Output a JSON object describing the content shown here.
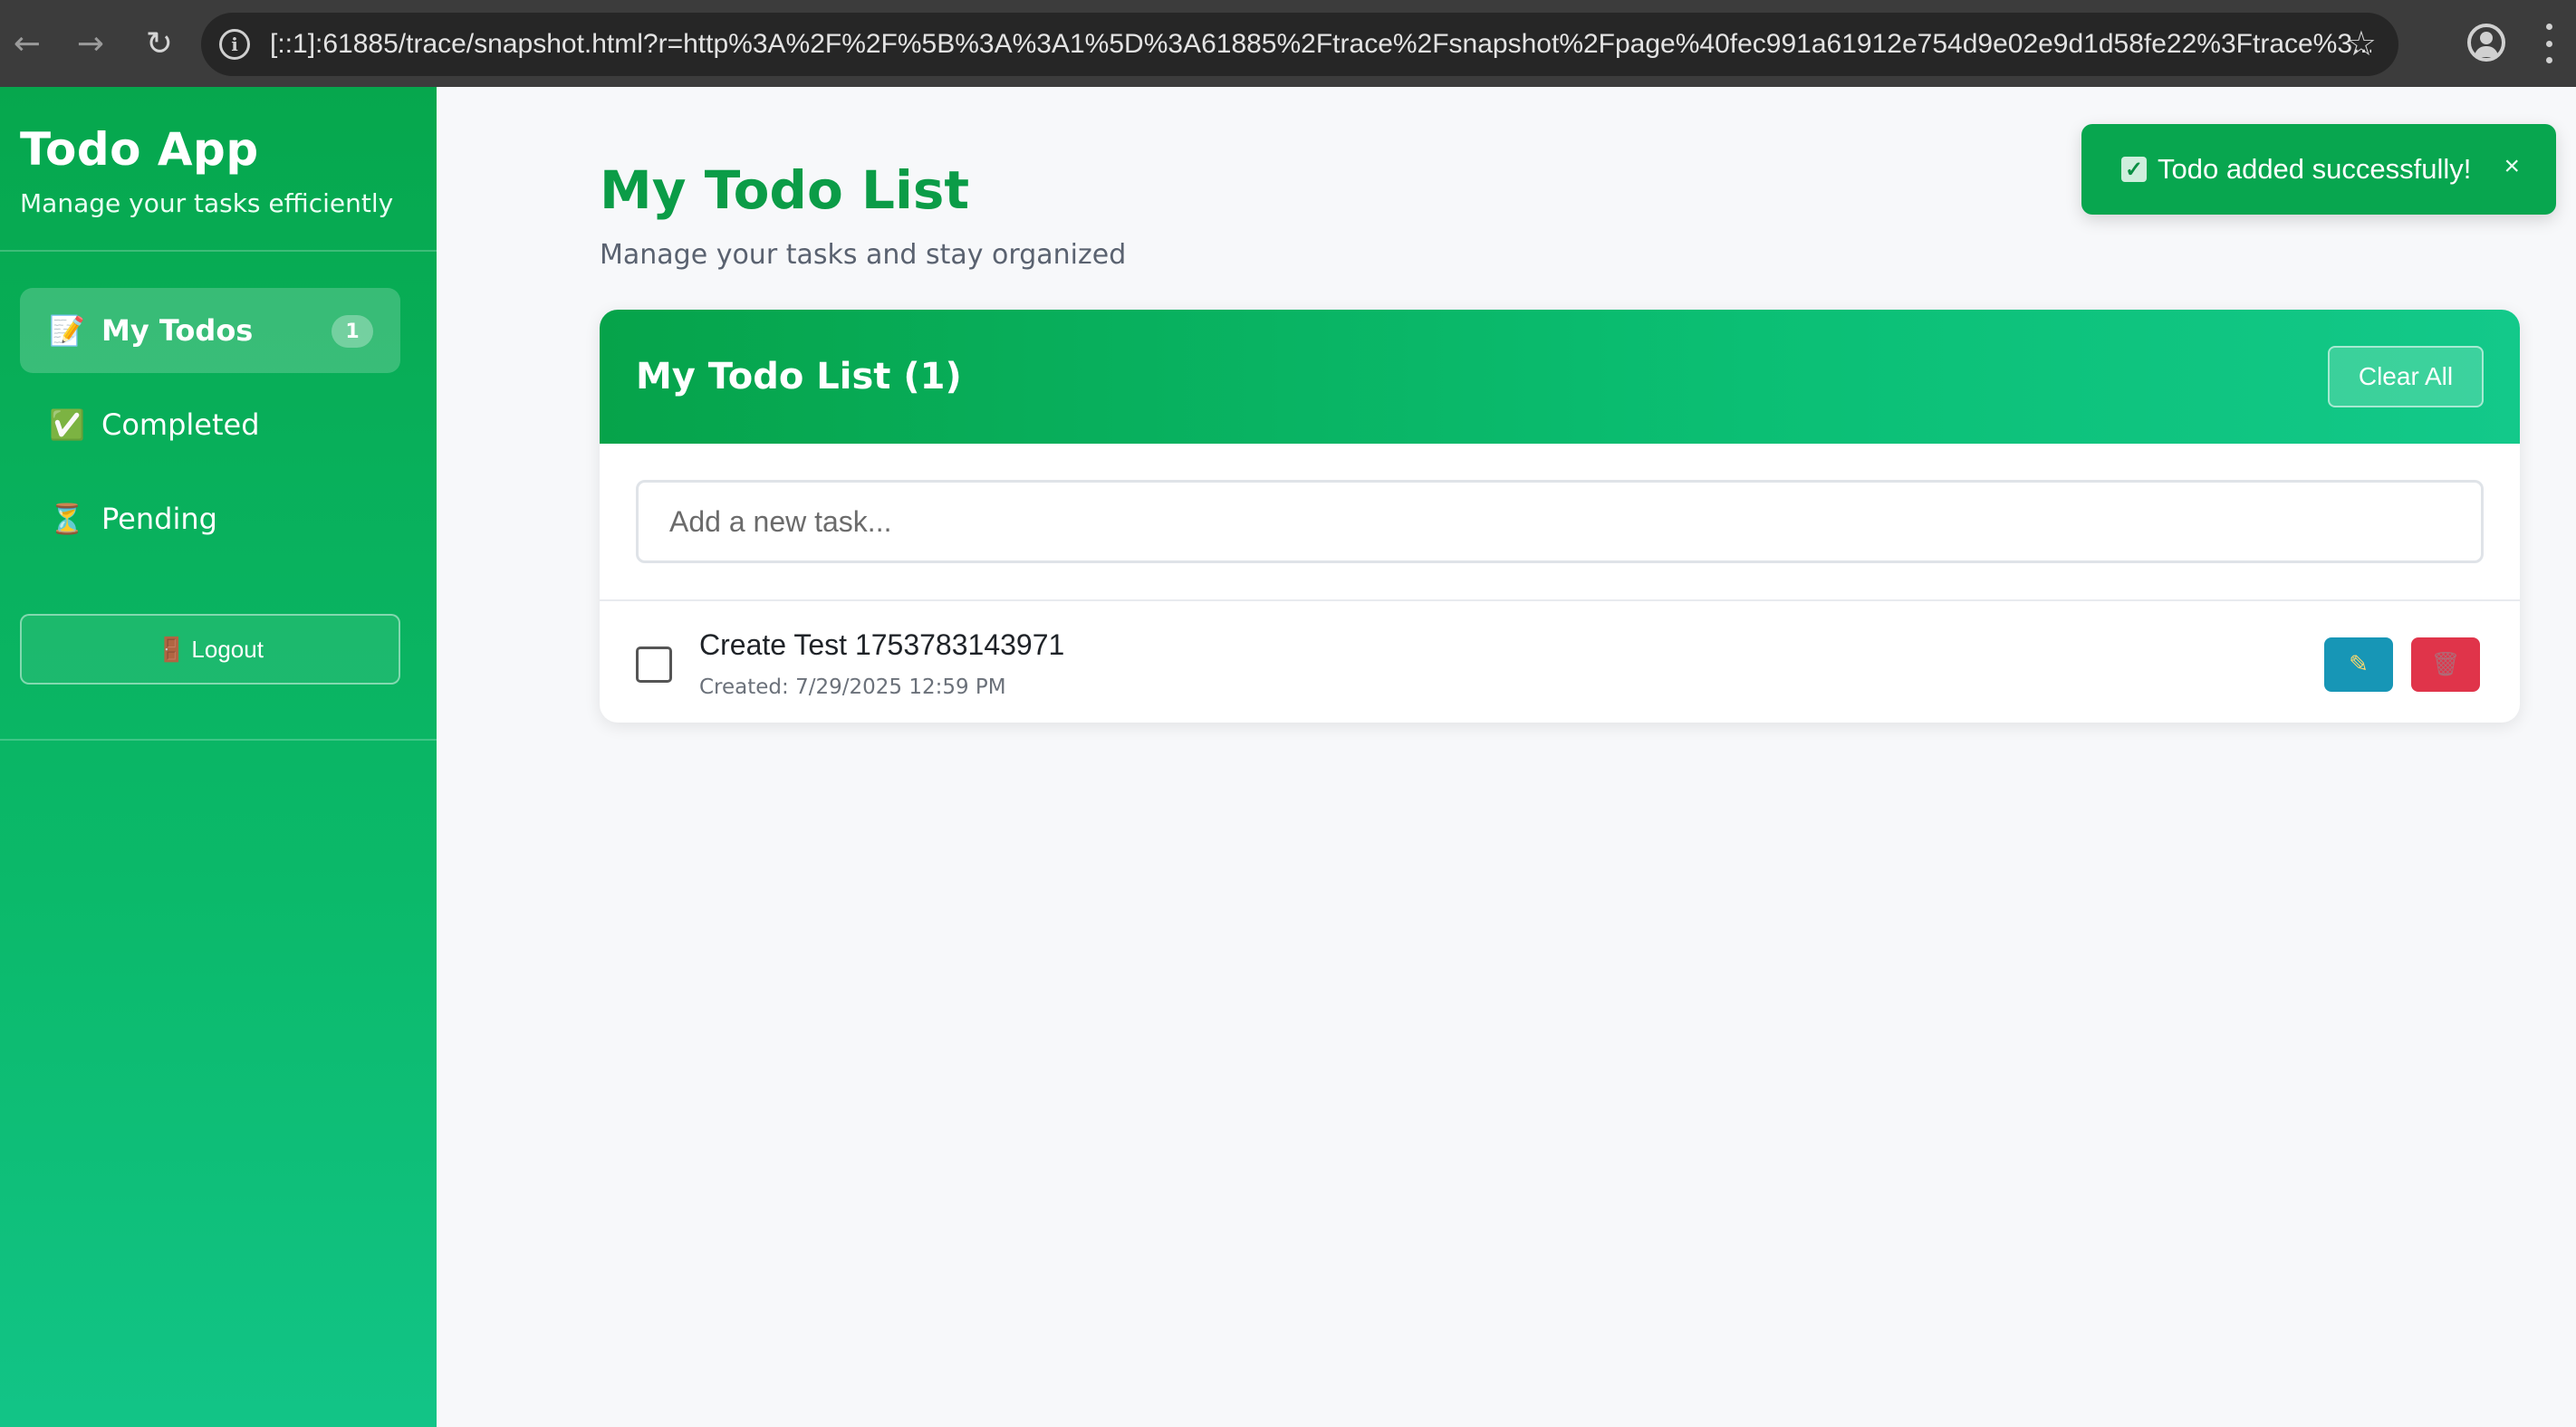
{
  "browser": {
    "url": "[::1]:61885/trace/snapshot.html?r=http%3A%2F%2F%5B%3A%3A1%5D%3A61885%2Ftrace%2Fsnapshot%2Fpage%40fec991a61912e754d9e02e9d1d58fe22%3Ftrace%3..."
  },
  "sidebar": {
    "title": "Todo App",
    "subtitle": "Manage your tasks efficiently",
    "items": [
      {
        "emoji": "📝",
        "label": "My Todos",
        "badge": "1"
      },
      {
        "emoji": "✅",
        "label": "Completed"
      },
      {
        "emoji": "⏳",
        "label": "Pending"
      }
    ],
    "logout": {
      "emoji": "🚪",
      "label": "Logout"
    }
  },
  "main": {
    "title": "My Todo List",
    "subtitle": "Manage your tasks and stay organized",
    "card": {
      "title": "My Todo List (1)",
      "clear_label": "Clear All",
      "input_placeholder": "Add a new task...",
      "todos": [
        {
          "text": "Create Test 1753783143971",
          "created": "Created: 7/29/2025 12:59 PM",
          "completed": false
        }
      ]
    }
  },
  "toast": {
    "message": "Todo added successfully!",
    "close": "×"
  },
  "colors": {
    "brand_green": "#0b9c47",
    "sidebar_top": "#06a74d",
    "sidebar_bottom": "#12c487",
    "edit_button": "#1796b6",
    "delete_button": "#e0344a"
  },
  "icons": {
    "back": "arrow-left-icon",
    "forward": "arrow-right-icon",
    "reload": "reload-icon",
    "info": "info-icon",
    "bookmark": "star-icon",
    "profile": "profile-icon",
    "menu": "kebab-menu-icon",
    "edit": "pencil-icon",
    "delete": "trash-icon"
  }
}
